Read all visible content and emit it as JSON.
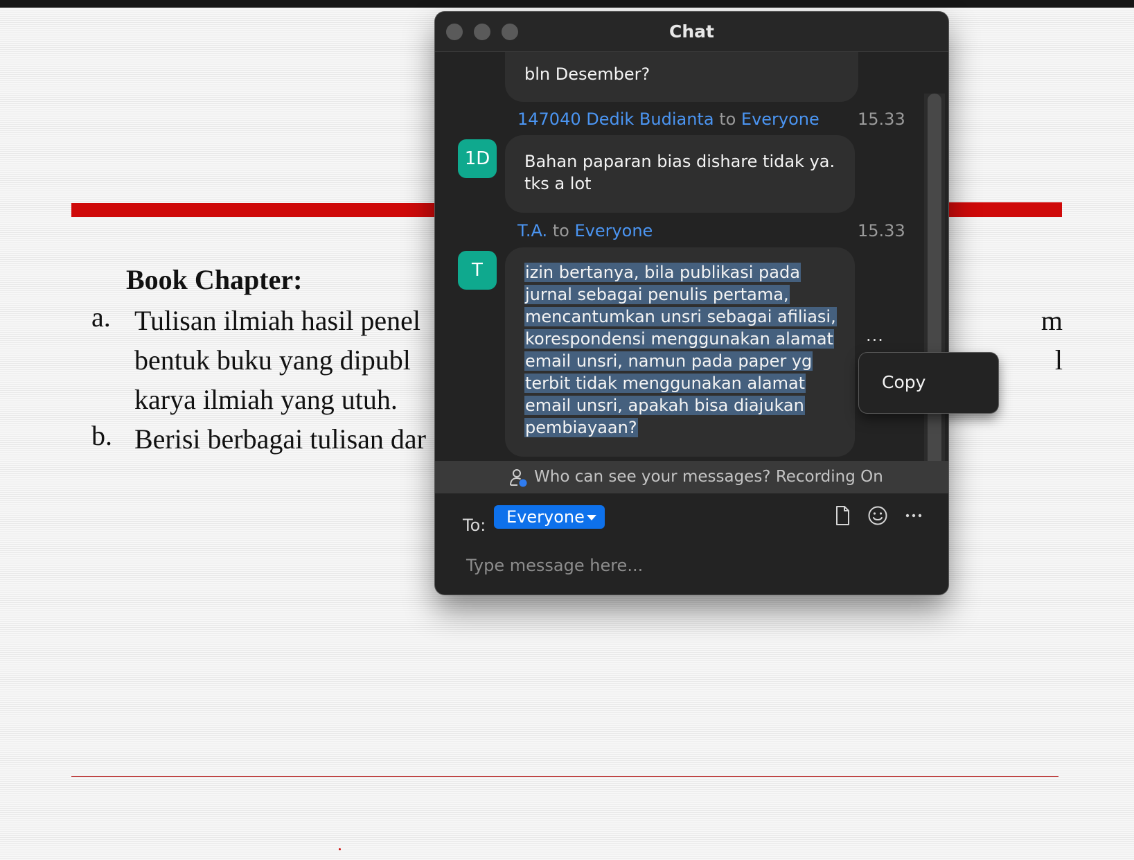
{
  "slide": {
    "heading": "Book Chapter:",
    "items": [
      {
        "marker": "a.",
        "lines": [
          "Tulisan ilmiah hasil penel",
          "bentuk buku yang dipubl",
          "karya ilmiah yang utuh."
        ],
        "right_fragments": [
          "m",
          "l"
        ]
      },
      {
        "marker": "b.",
        "lines": [
          "Berisi berbagai tulisan dar"
        ]
      }
    ]
  },
  "chat": {
    "title": "Chat",
    "messages": [
      {
        "text": "bln Desember?"
      },
      {
        "sender": "147040 Dedik Budianta",
        "to_word": "to",
        "recipient": "Everyone",
        "time": "15.33",
        "avatar": "1D",
        "lines": [
          "Bahan paparan bias dishare tidak ya.",
          "tks a lot"
        ]
      },
      {
        "sender": "T.A.",
        "to_word": "to",
        "recipient": "Everyone",
        "time": "15.33",
        "avatar": "T",
        "lines": [
          "izin bertanya, bila publikasi pada",
          "jurnal sebagai penulis pertama,",
          "mencantumkan unsri sebagai afiliasi,",
          "korespondensi menggunakan alamat",
          "email unsri, namun pada paper yg",
          "terbit tidak menggunakan alamat",
          "email unsri, apakah bisa diajukan",
          "pembiayaan?"
        ]
      }
    ],
    "more": "...",
    "notice": "Who can see your messages? Recording On",
    "to_label": "To:",
    "to_value": "Everyone",
    "placeholder": "Type message here..."
  },
  "context_menu": {
    "items": [
      {
        "label": "Copy"
      }
    ]
  },
  "colors": {
    "accent": "#0e71eb",
    "link": "#4b95f2",
    "avatar": "#0fa98e",
    "selection": "#45607e",
    "slide_red": "#cf0a0a"
  },
  "icons": [
    "user-visibility-icon",
    "file-icon",
    "emoji-icon",
    "more-icon",
    "dropdown-caret-icon"
  ]
}
